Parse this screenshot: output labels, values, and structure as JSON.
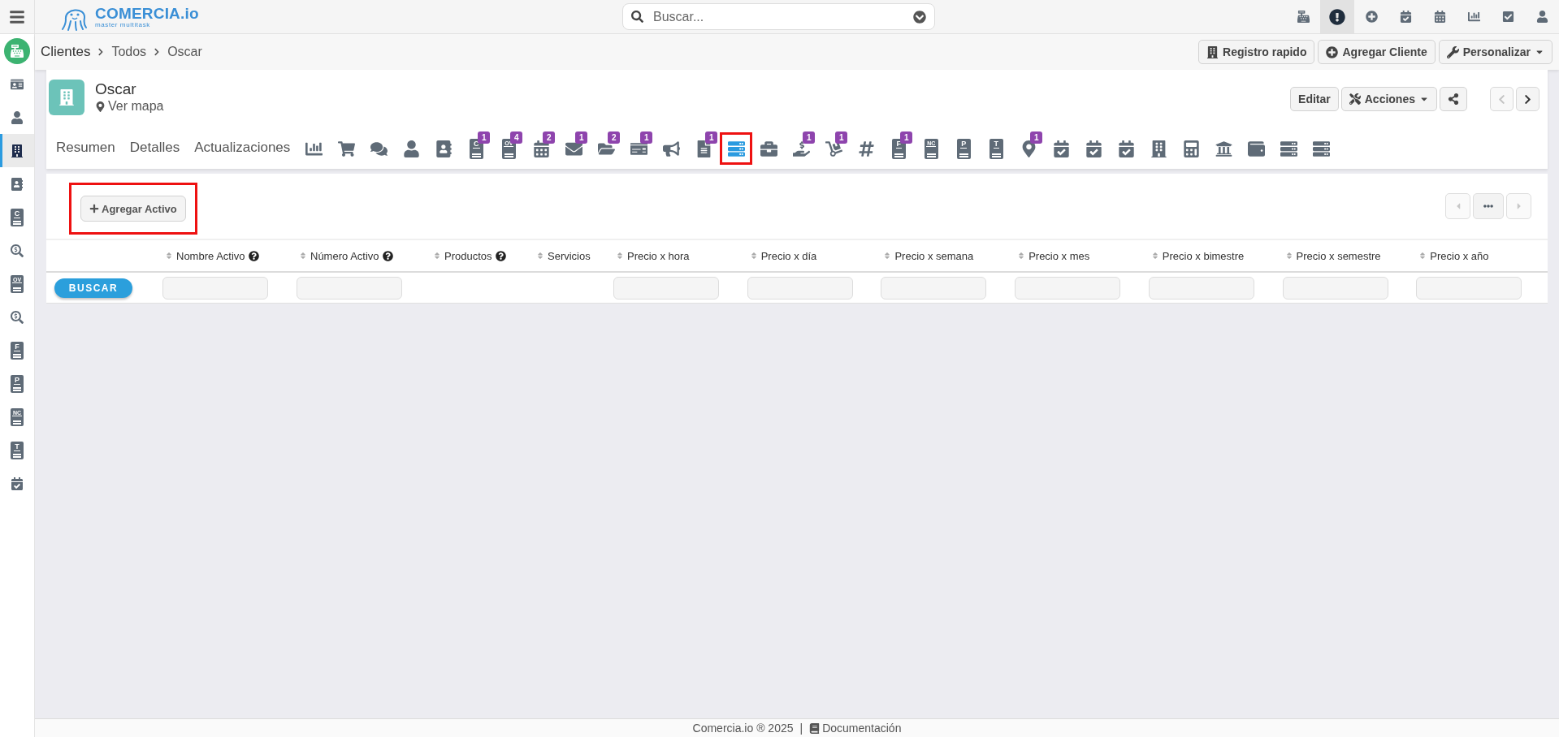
{
  "topbar": {
    "logo": {
      "name": "COMERCIA.io",
      "tagline": "master multitask"
    },
    "search": {
      "placeholder": "Buscar..."
    },
    "icons": [
      {
        "kind": "cash-register",
        "selected": false
      },
      {
        "kind": "alert",
        "selected": true
      },
      {
        "kind": "plus",
        "selected": false
      },
      {
        "kind": "calendar-check",
        "selected": false
      },
      {
        "kind": "calendar",
        "selected": false
      },
      {
        "kind": "bar-chart",
        "selected": false
      },
      {
        "kind": "checkbox",
        "selected": false
      },
      {
        "kind": "person",
        "selected": false
      }
    ]
  },
  "sidebar": {
    "items": [
      {
        "kind": "id-card",
        "selected": false
      },
      {
        "kind": "person",
        "selected": false
      },
      {
        "kind": "building",
        "selected": true
      },
      {
        "kind": "contact-book",
        "selected": false
      },
      {
        "kind": "letter-doc",
        "letter": "C",
        "selected": false
      },
      {
        "kind": "search-dollar",
        "selected": false
      },
      {
        "kind": "letter-doc",
        "letter": "OV",
        "selected": false
      },
      {
        "kind": "search-dollar",
        "selected": false
      },
      {
        "kind": "letter-doc",
        "letter": "F",
        "selected": false
      },
      {
        "kind": "letter-doc",
        "letter": "P",
        "selected": false
      },
      {
        "kind": "letter-doc",
        "letter": "NC",
        "selected": false
      },
      {
        "kind": "letter-doc",
        "letter": "T",
        "selected": false
      },
      {
        "kind": "calendar-check",
        "selected": false
      }
    ]
  },
  "breadcrumb": [
    "Clientes",
    "Todos",
    "Oscar"
  ],
  "actions": [
    {
      "label": "Registro rapido",
      "kind": "building",
      "dropdown": false
    },
    {
      "label": "Agregar Cliente",
      "kind": "plus",
      "dropdown": false
    },
    {
      "label": "Personalizar",
      "kind": "wrench",
      "dropdown": true
    }
  ],
  "record": {
    "name": "Oscar",
    "location_link": "Ver mapa",
    "buttons": [
      {
        "kind": "text",
        "label": "Editar"
      },
      {
        "kind": "tools",
        "label": "Acciones"
      },
      {
        "kind": "share"
      }
    ],
    "pager": [
      {
        "kind": "prev",
        "disabled": true
      },
      {
        "kind": "next",
        "disabled": false
      }
    ]
  },
  "tabs": [
    {
      "kind": "text",
      "label": "Resumen",
      "selected": false
    },
    {
      "kind": "text",
      "label": "Detalles",
      "selected": false
    },
    {
      "kind": "text",
      "label": "Actualizaciones",
      "selected": false
    },
    {
      "kind": "bar-chart",
      "selected": false
    },
    {
      "kind": "cart",
      "selected": false
    },
    {
      "kind": "speech-bubbles",
      "selected": false
    },
    {
      "kind": "person",
      "selected": false
    },
    {
      "kind": "contact-book",
      "selected": false
    },
    {
      "kind": "letter-doc",
      "letter": "C",
      "badge": "1",
      "selected": false
    },
    {
      "kind": "letter-doc",
      "letter": "OV",
      "badge": "4",
      "selected": false
    },
    {
      "kind": "calendar",
      "badge": "2",
      "selected": false
    },
    {
      "kind": "envelope",
      "badge": "1",
      "selected": false
    },
    {
      "kind": "folder",
      "badge": "2",
      "selected": false
    },
    {
      "kind": "money-check",
      "badge": "1",
      "selected": false
    },
    {
      "kind": "megaphone",
      "selected": false
    },
    {
      "kind": "document",
      "badge": "1",
      "selected": false
    },
    {
      "kind": "server",
      "selected": true,
      "annotated": true
    },
    {
      "kind": "briefcase",
      "selected": false
    },
    {
      "kind": "hand-dollar",
      "badge": "1",
      "selected": false
    },
    {
      "kind": "hand-truck",
      "badge": "1",
      "selected": false
    },
    {
      "kind": "hash",
      "selected": false
    },
    {
      "kind": "letter-doc",
      "letter": "F",
      "badge": "1",
      "selected": false
    },
    {
      "kind": "letter-doc",
      "letter": "NC",
      "selected": false
    },
    {
      "kind": "letter-doc",
      "letter": "P",
      "selected": false
    },
    {
      "kind": "letter-doc",
      "letter": "T",
      "selected": false
    },
    {
      "kind": "map-pin",
      "badge": "1",
      "selected": false
    },
    {
      "kind": "calendar-check",
      "selected": false
    },
    {
      "kind": "calendar-check",
      "selected": false
    },
    {
      "kind": "calendar-check",
      "selected": false
    },
    {
      "kind": "building",
      "selected": false
    },
    {
      "kind": "calculator",
      "selected": false
    },
    {
      "kind": "bank",
      "selected": false
    },
    {
      "kind": "wallet",
      "selected": false
    },
    {
      "kind": "server",
      "selected": false
    },
    {
      "kind": "server",
      "selected": false
    }
  ],
  "assets": {
    "add_button": {
      "label": "Agregar Activo",
      "annotated": true
    },
    "pager": [
      {
        "kind": "prev",
        "disabled": true
      },
      {
        "kind": "more",
        "disabled": false
      },
      {
        "kind": "next",
        "disabled": true
      }
    ],
    "search_button": "BUSCAR",
    "columns": [
      {
        "label": "Nombre Activo",
        "help": true,
        "filter": true
      },
      {
        "label": "Número Activo",
        "help": true,
        "filter": true
      },
      {
        "label": "Productos",
        "help": true,
        "filter": false
      },
      {
        "label": "Servicios",
        "help": false,
        "filter": false
      },
      {
        "label": "Precio x hora",
        "help": false,
        "filter": true
      },
      {
        "label": "Precio x día",
        "help": false,
        "filter": true
      },
      {
        "label": "Precio x semana",
        "help": false,
        "filter": true
      },
      {
        "label": "Precio x mes",
        "help": false,
        "filter": true
      },
      {
        "label": "Precio x bimestre",
        "help": false,
        "filter": true
      },
      {
        "label": "Precio x semestre",
        "help": false,
        "filter": true
      },
      {
        "label": "Precio x año",
        "help": false,
        "filter": true
      }
    ]
  },
  "footer": {
    "copyright": "Comercia.io ® 2025",
    "separator": "|",
    "link": "Documentación"
  }
}
